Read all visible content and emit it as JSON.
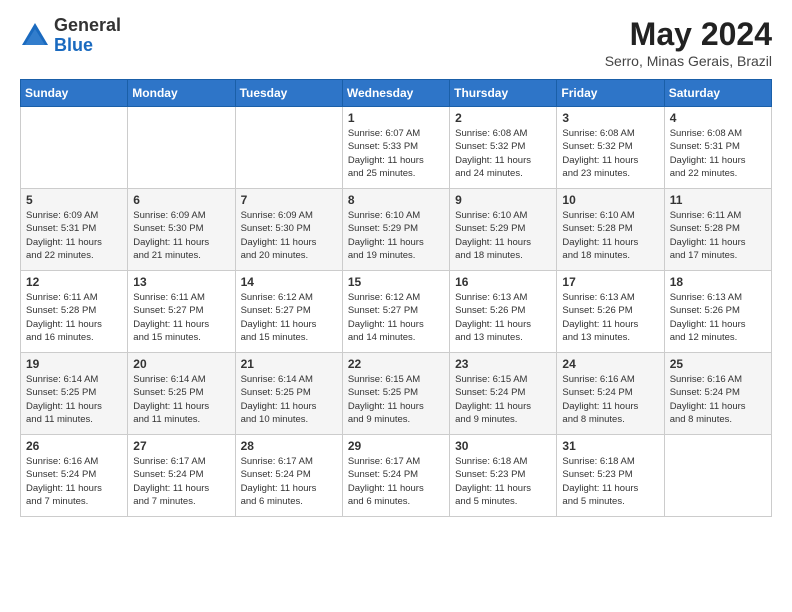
{
  "header": {
    "logo": {
      "general": "General",
      "blue": "Blue"
    },
    "title": "May 2024",
    "location": "Serro, Minas Gerais, Brazil"
  },
  "weekdays": [
    "Sunday",
    "Monday",
    "Tuesday",
    "Wednesday",
    "Thursday",
    "Friday",
    "Saturday"
  ],
  "weeks": [
    [
      {
        "day": "",
        "info": ""
      },
      {
        "day": "",
        "info": ""
      },
      {
        "day": "",
        "info": ""
      },
      {
        "day": "1",
        "info": "Sunrise: 6:07 AM\nSunset: 5:33 PM\nDaylight: 11 hours\nand 25 minutes."
      },
      {
        "day": "2",
        "info": "Sunrise: 6:08 AM\nSunset: 5:32 PM\nDaylight: 11 hours\nand 24 minutes."
      },
      {
        "day": "3",
        "info": "Sunrise: 6:08 AM\nSunset: 5:32 PM\nDaylight: 11 hours\nand 23 minutes."
      },
      {
        "day": "4",
        "info": "Sunrise: 6:08 AM\nSunset: 5:31 PM\nDaylight: 11 hours\nand 22 minutes."
      }
    ],
    [
      {
        "day": "5",
        "info": "Sunrise: 6:09 AM\nSunset: 5:31 PM\nDaylight: 11 hours\nand 22 minutes."
      },
      {
        "day": "6",
        "info": "Sunrise: 6:09 AM\nSunset: 5:30 PM\nDaylight: 11 hours\nand 21 minutes."
      },
      {
        "day": "7",
        "info": "Sunrise: 6:09 AM\nSunset: 5:30 PM\nDaylight: 11 hours\nand 20 minutes."
      },
      {
        "day": "8",
        "info": "Sunrise: 6:10 AM\nSunset: 5:29 PM\nDaylight: 11 hours\nand 19 minutes."
      },
      {
        "day": "9",
        "info": "Sunrise: 6:10 AM\nSunset: 5:29 PM\nDaylight: 11 hours\nand 18 minutes."
      },
      {
        "day": "10",
        "info": "Sunrise: 6:10 AM\nSunset: 5:28 PM\nDaylight: 11 hours\nand 18 minutes."
      },
      {
        "day": "11",
        "info": "Sunrise: 6:11 AM\nSunset: 5:28 PM\nDaylight: 11 hours\nand 17 minutes."
      }
    ],
    [
      {
        "day": "12",
        "info": "Sunrise: 6:11 AM\nSunset: 5:28 PM\nDaylight: 11 hours\nand 16 minutes."
      },
      {
        "day": "13",
        "info": "Sunrise: 6:11 AM\nSunset: 5:27 PM\nDaylight: 11 hours\nand 15 minutes."
      },
      {
        "day": "14",
        "info": "Sunrise: 6:12 AM\nSunset: 5:27 PM\nDaylight: 11 hours\nand 15 minutes."
      },
      {
        "day": "15",
        "info": "Sunrise: 6:12 AM\nSunset: 5:27 PM\nDaylight: 11 hours\nand 14 minutes."
      },
      {
        "day": "16",
        "info": "Sunrise: 6:13 AM\nSunset: 5:26 PM\nDaylight: 11 hours\nand 13 minutes."
      },
      {
        "day": "17",
        "info": "Sunrise: 6:13 AM\nSunset: 5:26 PM\nDaylight: 11 hours\nand 13 minutes."
      },
      {
        "day": "18",
        "info": "Sunrise: 6:13 AM\nSunset: 5:26 PM\nDaylight: 11 hours\nand 12 minutes."
      }
    ],
    [
      {
        "day": "19",
        "info": "Sunrise: 6:14 AM\nSunset: 5:25 PM\nDaylight: 11 hours\nand 11 minutes."
      },
      {
        "day": "20",
        "info": "Sunrise: 6:14 AM\nSunset: 5:25 PM\nDaylight: 11 hours\nand 11 minutes."
      },
      {
        "day": "21",
        "info": "Sunrise: 6:14 AM\nSunset: 5:25 PM\nDaylight: 11 hours\nand 10 minutes."
      },
      {
        "day": "22",
        "info": "Sunrise: 6:15 AM\nSunset: 5:25 PM\nDaylight: 11 hours\nand 9 minutes."
      },
      {
        "day": "23",
        "info": "Sunrise: 6:15 AM\nSunset: 5:24 PM\nDaylight: 11 hours\nand 9 minutes."
      },
      {
        "day": "24",
        "info": "Sunrise: 6:16 AM\nSunset: 5:24 PM\nDaylight: 11 hours\nand 8 minutes."
      },
      {
        "day": "25",
        "info": "Sunrise: 6:16 AM\nSunset: 5:24 PM\nDaylight: 11 hours\nand 8 minutes."
      }
    ],
    [
      {
        "day": "26",
        "info": "Sunrise: 6:16 AM\nSunset: 5:24 PM\nDaylight: 11 hours\nand 7 minutes."
      },
      {
        "day": "27",
        "info": "Sunrise: 6:17 AM\nSunset: 5:24 PM\nDaylight: 11 hours\nand 7 minutes."
      },
      {
        "day": "28",
        "info": "Sunrise: 6:17 AM\nSunset: 5:24 PM\nDaylight: 11 hours\nand 6 minutes."
      },
      {
        "day": "29",
        "info": "Sunrise: 6:17 AM\nSunset: 5:24 PM\nDaylight: 11 hours\nand 6 minutes."
      },
      {
        "day": "30",
        "info": "Sunrise: 6:18 AM\nSunset: 5:23 PM\nDaylight: 11 hours\nand 5 minutes."
      },
      {
        "day": "31",
        "info": "Sunrise: 6:18 AM\nSunset: 5:23 PM\nDaylight: 11 hours\nand 5 minutes."
      },
      {
        "day": "",
        "info": ""
      }
    ]
  ]
}
